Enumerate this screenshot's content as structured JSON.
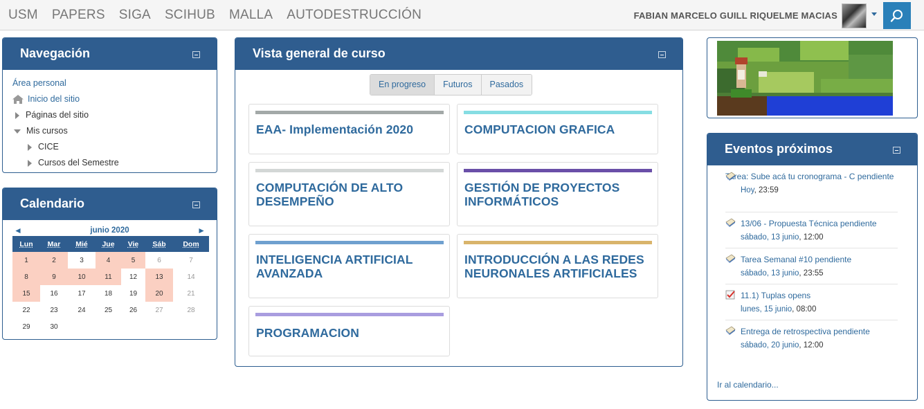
{
  "navbar": {
    "links": [
      "USM",
      "PAPERS",
      "SIGA",
      "SCIHUB",
      "MALLA",
      "AUTODESTRUCCIÓN"
    ],
    "user_name": "FABIAN MARCELO GUILL RIQUELME MACIAS",
    "search_icon": "search-icon"
  },
  "navigation": {
    "title": "Navegación",
    "items": [
      "Área personal",
      "Inicio del sitio",
      "Páginas del sitio",
      "Mis cursos",
      "CICE",
      "Cursos del Semestre"
    ]
  },
  "calendar": {
    "title": "Calendario",
    "prev": "◄",
    "next": "►",
    "month": "junio 2020",
    "weekdays": [
      "Lun",
      "Mar",
      "Mié",
      "Jue",
      "Vie",
      "Sáb",
      "Dom"
    ],
    "weeks": [
      [
        "1",
        "2",
        "3",
        "4",
        "5",
        "6",
        "7"
      ],
      [
        "8",
        "9",
        "10",
        "11",
        "12",
        "13",
        "14"
      ],
      [
        "15",
        "16",
        "17",
        "18",
        "19",
        "20",
        "21"
      ],
      [
        "22",
        "23",
        "24",
        "25",
        "26",
        "27",
        "28"
      ],
      [
        "29",
        "30",
        "",
        "",
        "",
        "",
        ""
      ]
    ],
    "event_days": [
      "1",
      "2",
      "4",
      "5",
      "8",
      "9",
      "10",
      "11",
      "13",
      "15",
      "20"
    ]
  },
  "overview": {
    "title": "Vista general de curso",
    "tabs": [
      "En progreso",
      "Futuros",
      "Pasados"
    ],
    "active_tab": "En progreso",
    "courses": [
      {
        "name": "EAA- Implementación 2020",
        "color": "#a3a9a8"
      },
      {
        "name": "COMPUTACION GRAFICA",
        "color": "#86dde3"
      },
      {
        "name": "COMPUTACIÓN DE ALTO DESEMPEÑO",
        "color": "#d3d7d6"
      },
      {
        "name": "GESTIÓN DE PROYECTOS INFORMÁTICOS",
        "color": "#6a4fa8"
      },
      {
        "name": "INTELIGENCIA ARTIFICIAL AVANZADA",
        "color": "#6fa0cf"
      },
      {
        "name": "INTRODUCCIÓN A LAS REDES NEURONALES ARTIFICIALES",
        "color": "#d9b46b"
      },
      {
        "name": "PROGRAMACION",
        "color": "#a99ddf"
      }
    ]
  },
  "events": {
    "title": "Eventos próximos",
    "items": [
      {
        "name": "Tarea: Sube acá tu cronograma - C pendiente",
        "time_prefix": "Hoy",
        "time": ", 23:59",
        "icon": "assignment-icon"
      },
      {
        "name": "13/06 - Propuesta Técnica pendiente",
        "time_prefix": "sábado, 13 junio",
        "time": ", 12:00",
        "icon": "assignment-icon"
      },
      {
        "name": "Tarea Semanal #10 pendiente",
        "time_prefix": "sábado, 13 junio",
        "time": ", 23:55",
        "icon": "assignment-icon"
      },
      {
        "name": "11.1) Tuplas opens",
        "time_prefix": "lunes, 15 junio",
        "time": ", 08:00",
        "icon": "quiz-icon"
      },
      {
        "name": "Entrega de retrospectiva pendiente",
        "time_prefix": "sábado, 20 junio",
        "time": ", 12:00",
        "icon": "assignment-icon"
      }
    ],
    "calendar_link": "Ir al calendario..."
  }
}
